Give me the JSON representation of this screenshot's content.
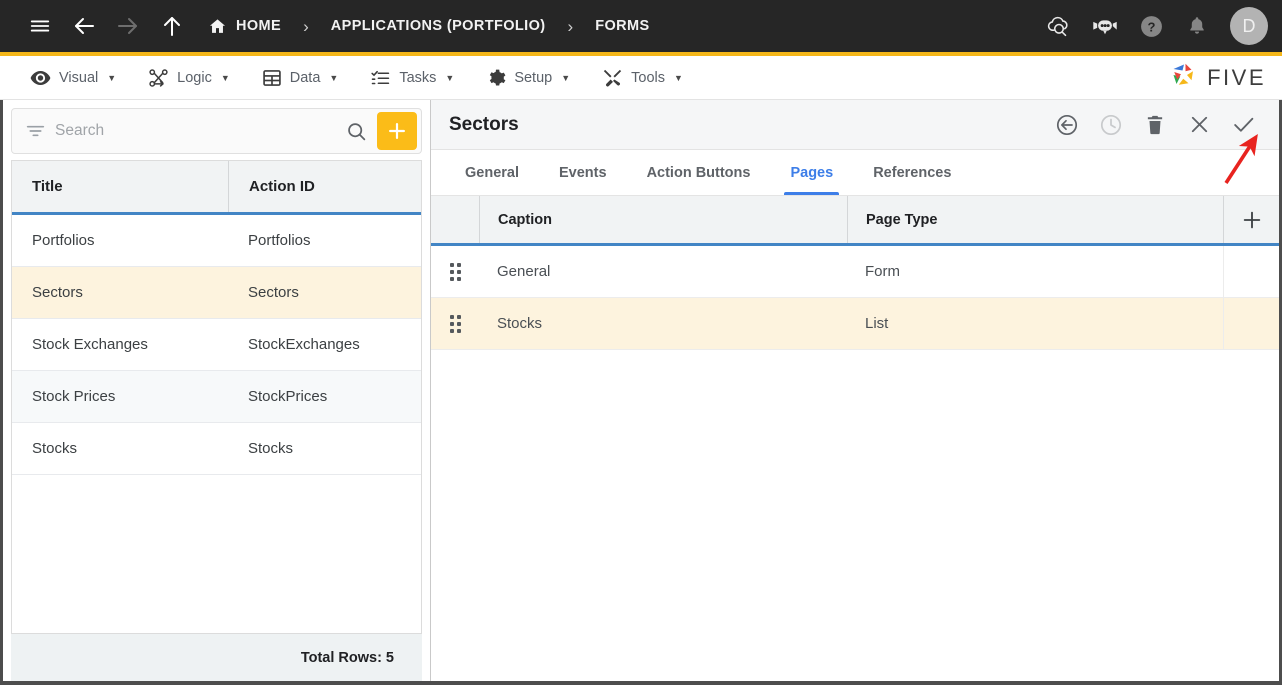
{
  "topbar": {
    "menu_icon": "hamburger-menu-icon",
    "back_icon": "arrow-left-icon",
    "forward_icon": "arrow-right-icon",
    "up_icon": "arrow-up-icon",
    "breadcrumbs": [
      {
        "label": "HOME",
        "icon": "home-icon"
      },
      {
        "label": "APPLICATIONS (PORTFOLIO)",
        "icon": ""
      },
      {
        "label": "FORMS",
        "icon": ""
      }
    ],
    "separator": "›",
    "right_icons": [
      {
        "name": "cloud-search-icon"
      },
      {
        "name": "chat-bot-icon"
      },
      {
        "name": "help-icon"
      },
      {
        "name": "notifications-bell-icon"
      }
    ],
    "avatar_initial": "D"
  },
  "menubar": {
    "items": [
      {
        "label": "Visual",
        "icon": "eye-icon",
        "caret": "▼"
      },
      {
        "label": "Logic",
        "icon": "flow-nodes-icon",
        "caret": "▼"
      },
      {
        "label": "Data",
        "icon": "table-grid-icon",
        "caret": "▼"
      },
      {
        "label": "Tasks",
        "icon": "checklist-icon",
        "caret": "▼"
      },
      {
        "label": "Setup",
        "icon": "gear-icon",
        "caret": "▼"
      },
      {
        "label": "Tools",
        "icon": "tools-cross-icon",
        "caret": "▼"
      }
    ],
    "brand": "FIVE"
  },
  "left_panel": {
    "search": {
      "placeholder": "Search",
      "value": "",
      "filter_icon": "filter-icon",
      "search_icon": "search-icon",
      "add_label": "+"
    },
    "columns": [
      "Title",
      "Action ID"
    ],
    "rows": [
      {
        "title": "Portfolios",
        "action_id": "Portfolios"
      },
      {
        "title": "Sectors",
        "action_id": "Sectors"
      },
      {
        "title": "Stock Exchanges",
        "action_id": "StockExchanges"
      },
      {
        "title": "Stock Prices",
        "action_id": "StockPrices"
      },
      {
        "title": "Stocks",
        "action_id": "Stocks"
      }
    ],
    "selected_index": 1,
    "footer": "Total Rows: 5"
  },
  "right_panel": {
    "title": "Sectors",
    "actions": [
      {
        "name": "back-circle-icon"
      },
      {
        "name": "history-clock-icon"
      },
      {
        "name": "delete-trash-icon"
      },
      {
        "name": "close-x-icon"
      },
      {
        "name": "save-check-icon"
      }
    ],
    "tabs": [
      {
        "label": "General"
      },
      {
        "label": "Events"
      },
      {
        "label": "Action Buttons"
      },
      {
        "label": "Pages"
      },
      {
        "label": "References"
      }
    ],
    "active_tab": 3,
    "pages_grid": {
      "columns": [
        "Caption",
        "Page Type"
      ],
      "add_label": "+",
      "rows": [
        {
          "drag": "drag-handle-icon",
          "caption": "General",
          "page_type": "Form"
        },
        {
          "drag": "drag-handle-icon",
          "caption": "Stocks",
          "page_type": "List"
        }
      ],
      "selected_index": 1
    }
  },
  "colors": {
    "header_bg": "#262626",
    "accent": "#f5b719",
    "grid_underline": "#4285c5",
    "selected_row": "#fdf3de",
    "tab_active": "#3d7ee8",
    "annotation_arrow": "#e8231f"
  }
}
